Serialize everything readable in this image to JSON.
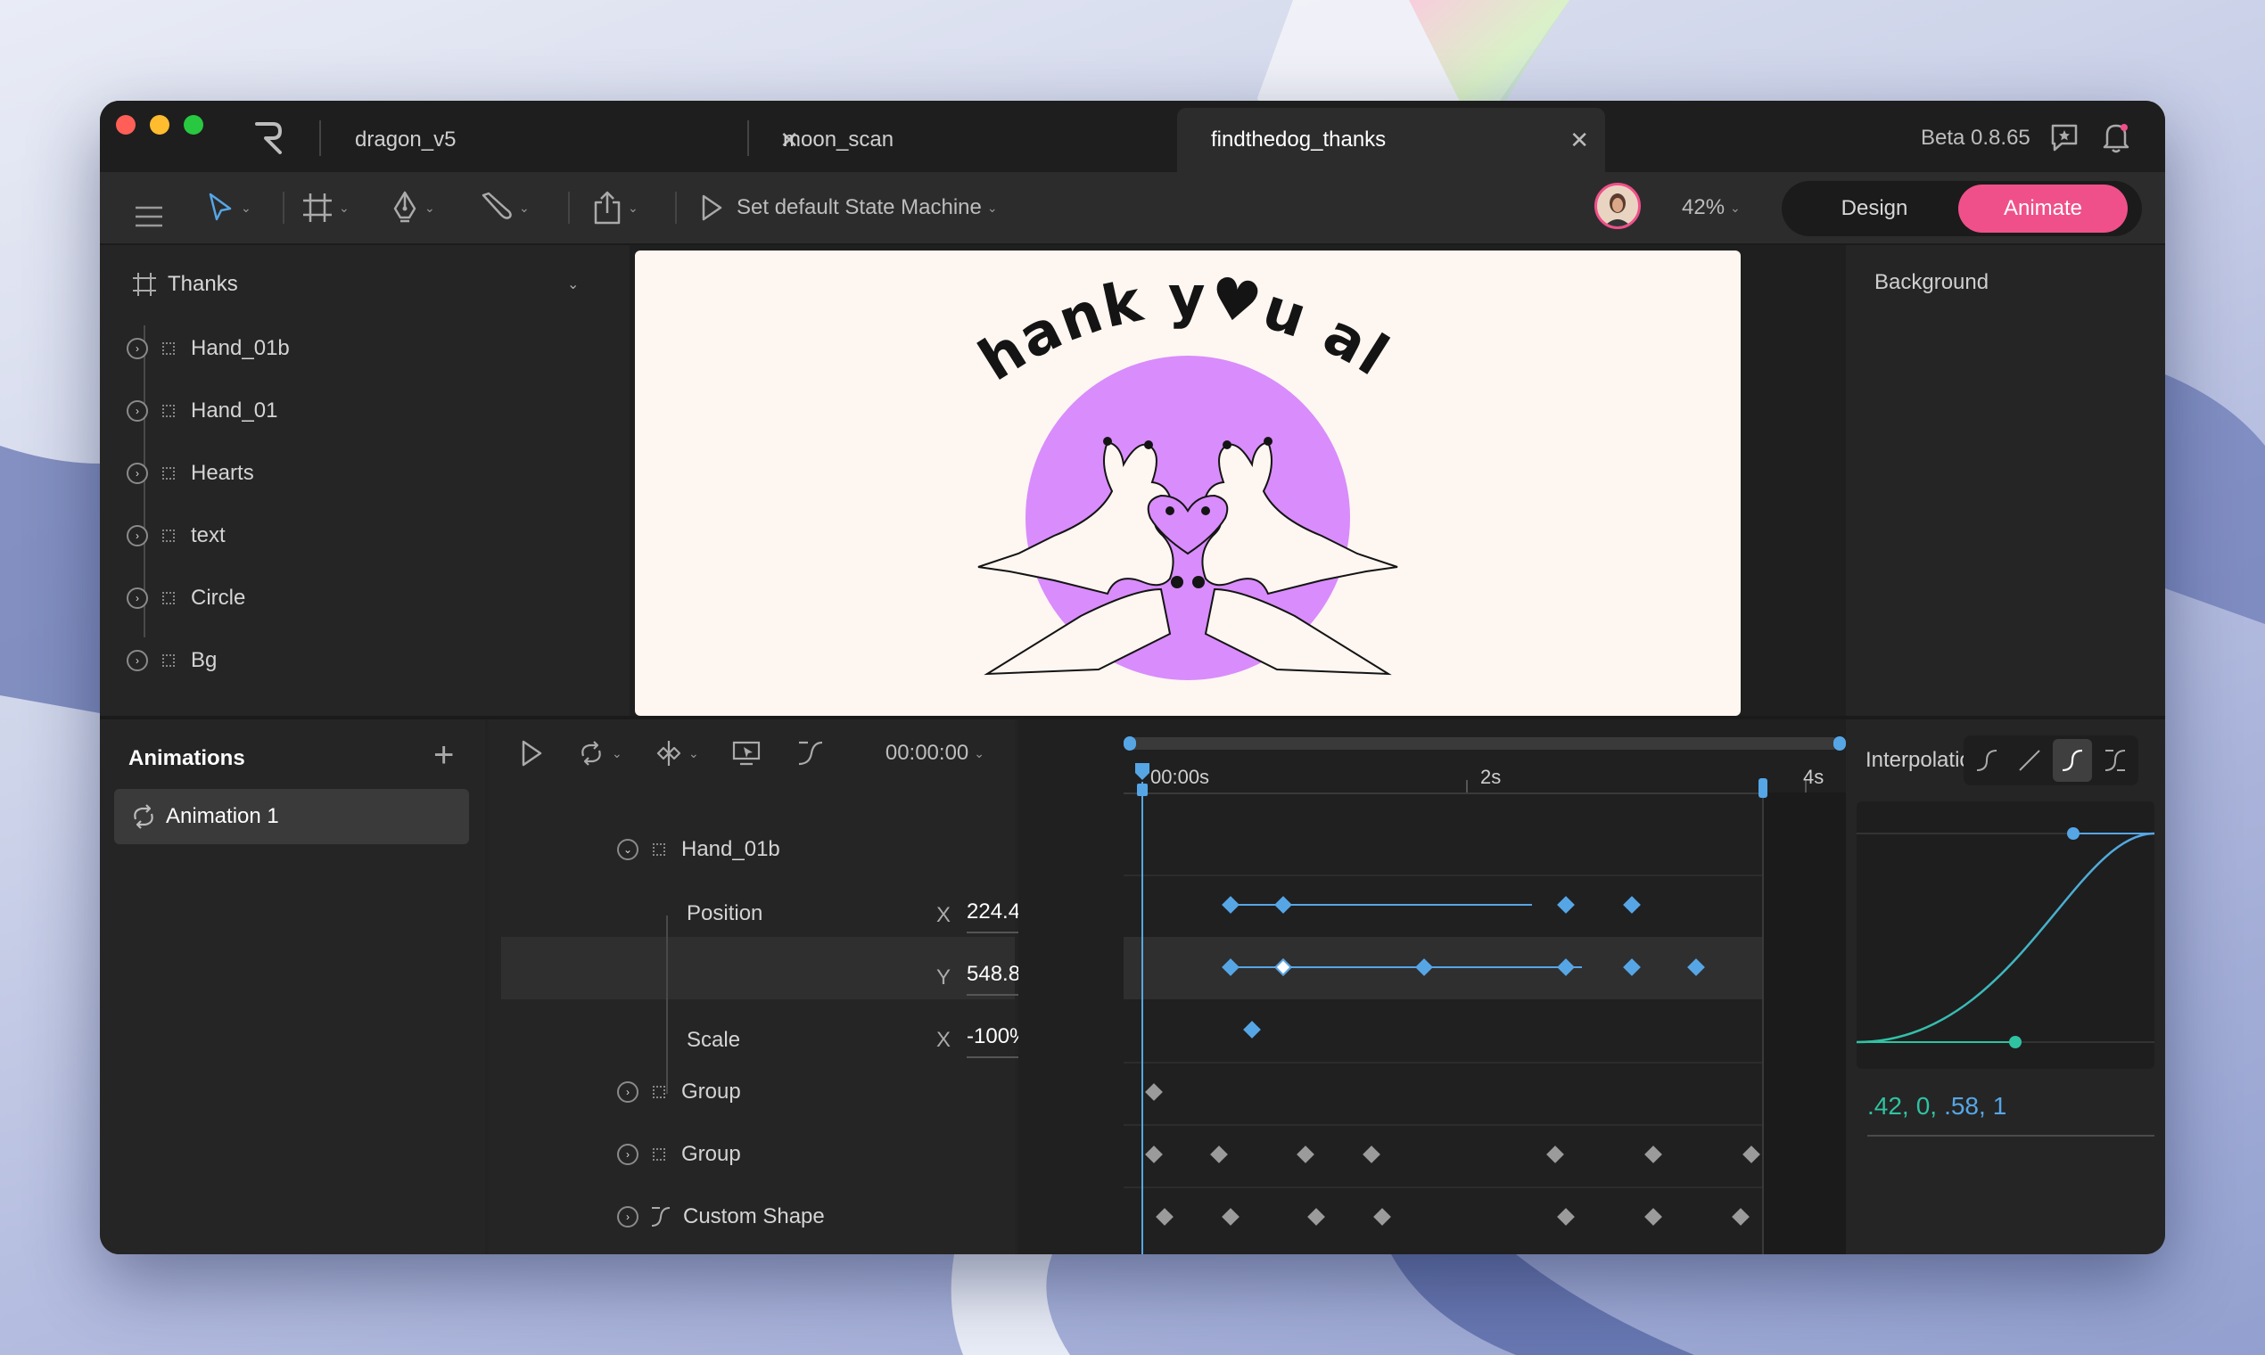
{
  "tabs": [
    {
      "label": "dragon_v5"
    },
    {
      "label": "moon_scan"
    },
    {
      "label": "findthedog_thanks"
    }
  ],
  "titlebar": {
    "version": "Beta 0.8.65"
  },
  "toolbar": {
    "state_machine_label": "Set default State Machine",
    "zoom": "42%",
    "design_label": "Design",
    "animate_label": "Animate"
  },
  "hierarchy": {
    "root": "Thanks",
    "items": [
      "Hand_01b",
      "Hand_01",
      "Hearts",
      "text",
      "Circle",
      "Bg"
    ]
  },
  "canvas": {
    "headline": "Thank y♥u all!"
  },
  "inspector": {
    "background_label": "Background",
    "background_color": "#fdf6f1"
  },
  "animations": {
    "title": "Animations",
    "items": [
      "Animation 1"
    ]
  },
  "timeline": {
    "time": "00:00:00",
    "ruler": [
      "00:00s",
      "2s",
      "4s"
    ],
    "rows": {
      "hand": "Hand_01b",
      "position": "Position",
      "x_axis": "X",
      "x_value": "224.4",
      "y_axis": "Y",
      "y_value": "548.8",
      "scale": "Scale",
      "scale_axis": "X",
      "scale_value": "-100%",
      "group1": "Group",
      "group2": "Group",
      "custom": "Custom Shape"
    }
  },
  "interpolation": {
    "title": "Interpolation",
    "values": ".42, 0, .58, 1",
    "v1": ".42,",
    "v2": "0,",
    "v3": ".58,",
    "v4": "1"
  },
  "colors": {
    "accent": "#f0508a",
    "keyframe": "#56a6e6",
    "circle": "#d98cfb",
    "canvas_bg": "#fdf6f1"
  }
}
